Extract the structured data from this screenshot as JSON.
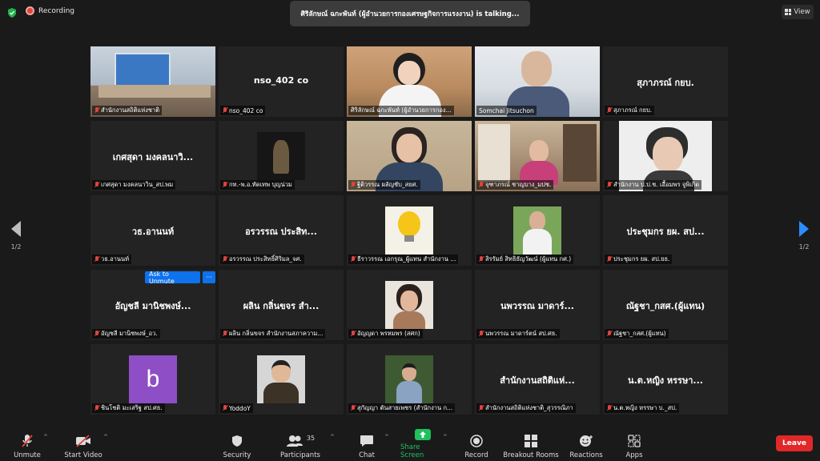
{
  "top": {
    "recording_label": "Recording",
    "talking_banner": "ศิริลักษณ์ ฉกะพันท์ (ผู้อำนวยการกองเศรษฐกิจการแรงงาน) is  talking...",
    "view_label": "View"
  },
  "pagination": {
    "left": "1/2",
    "right": "1/2"
  },
  "tiles": [
    {
      "big": "",
      "label": "สำนักงานสถิติแห่งชาติ"
    },
    {
      "big": "nso_402 co",
      "label": "nso_402 co"
    },
    {
      "big": "",
      "label": "ศิริลักษณ์ ฉกะพันท์ (ผู้อำนวยการกอง..."
    },
    {
      "big": "",
      "label": "Somchai Jitsuchon"
    },
    {
      "big": "สุภาภรณ์ กยบ.",
      "label": "สุภาภรณ์ กยบ."
    },
    {
      "big": "เกศสุดา มงคลนาวิ...",
      "label": "เกศสุดา มงคลนาวิน_สป.พม"
    },
    {
      "big": "",
      "label": "กท.-พ.อ.ทัดเทพ บุญน่วม"
    },
    {
      "big": "",
      "label": "ฐิติวรรณ ผลัญชับ_สยศ."
    },
    {
      "big": "",
      "label": "จุฑาภรณ์ ชาญบาง_มปช."
    },
    {
      "big": "",
      "label": "สำนักงาน ป.ป.ช. เอื้อมพร จูพิเกิด"
    },
    {
      "big": "วธ.อานนท์",
      "label": "วธ.อานนท์"
    },
    {
      "big": "อรวรรณ  ประสิท...",
      "label": "อรวรรณ  ประสิทธิ์ศิริมล_จศ."
    },
    {
      "big": "",
      "label": "ธีราวรรณ เอกรุณ_ผู้แทน สำนักงาน ..."
    },
    {
      "big": "",
      "label": "สิรรัมย์ สิทธิธัญวัฒน์ (ผู้แทน กศ.)"
    },
    {
      "big": "ประชุมกร ยผ. สป...",
      "label": "ประชุมกร ยผ. สป.ยธ."
    },
    {
      "big": "อัญชลี มานิชพงษ์...",
      "label": "อัญชลี มานิชพงษ์_อว."
    },
    {
      "big": "ผลิน กลิ่นขจร สำ...",
      "label": "ผลิน กลิ่นขจร สำนักงานสภาความ..."
    },
    {
      "big": "",
      "label": "อัญญดา พรหมพร (สศก)"
    },
    {
      "big": "นพวรรณ มาดาร์...",
      "label": "นพวรรณ มาดาร์ตน์ สป.ศธ."
    },
    {
      "big": "ณัฐชา_กสศ.(ผู้แทน)",
      "label": "ณัฐชา_กสศ.(ผู้แทน)"
    },
    {
      "big": "",
      "label": "ชินโชติ มะเสริฐ สป.ศธ."
    },
    {
      "big": "",
      "label": "YoddoY"
    },
    {
      "big": "",
      "label": "สุกัญญา ตันสายเพชร (สำนักงาน ก..."
    },
    {
      "big": "สำนักงานสถิติแห่...",
      "label": "สำนักงานสถิติแห่งชาติ_สุวรรณิภา"
    },
    {
      "big": "น.ต.หญิง หรรษา...",
      "label": "น.ต.หญิง หรรษา บ._สป."
    }
  ],
  "unmute": {
    "ask": "Ask to Unmute",
    "more": "···"
  },
  "avatar_letter": "b",
  "toolbar": {
    "unmute": "Unmute",
    "start_video": "Start Video",
    "security": "Security",
    "participants": "Participants",
    "participants_count": "35",
    "chat": "Chat",
    "share_screen": "Share Screen",
    "record": "Record",
    "breakout": "Breakout Rooms",
    "reactions": "Reactions",
    "apps": "Apps",
    "leave": "Leave"
  },
  "colors": {
    "speaking_border": "#b6e23c",
    "share_green": "#20c05c",
    "leave_red": "#e02828",
    "ask_blue": "#0e72ed",
    "nav_arrow_blue": "#2d8cff"
  }
}
